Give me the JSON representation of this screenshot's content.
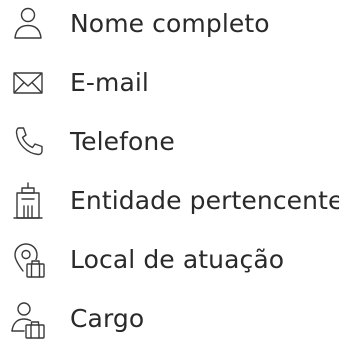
{
  "fields": [
    {
      "label": "Nome completo",
      "icon": "user-icon"
    },
    {
      "label": "E-mail",
      "icon": "envelope-icon"
    },
    {
      "label": "Telefone",
      "icon": "phone-icon"
    },
    {
      "label": "Entidade pertencente",
      "icon": "building-icon"
    },
    {
      "label": "Local de atuação",
      "icon": "location-briefcase-icon"
    },
    {
      "label": "Cargo",
      "icon": "user-briefcase-icon"
    }
  ]
}
